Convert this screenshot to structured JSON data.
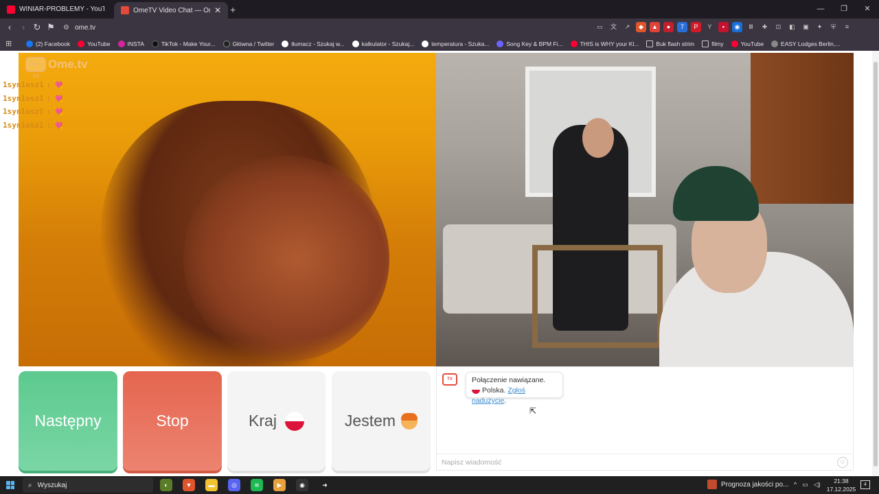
{
  "browser": {
    "tabs": [
      {
        "title": "WINIAR-PROBLEMY - YouTube",
        "favicon_color": "#ff0033"
      },
      {
        "title": "OmeTV Video Chat — Omeg",
        "favicon_color": "#e24b3b",
        "active": true
      }
    ],
    "new_tab_label": "+",
    "url": "ome.tv",
    "bookmarks": [
      {
        "label": "(2) Facebook",
        "icon_color": "#1877f2"
      },
      {
        "label": "YouTube",
        "icon_color": "#ff0033"
      },
      {
        "label": "INSTA",
        "icon_color": "#d6249f"
      },
      {
        "label": "TikTok - Make Your...",
        "icon_color": "#111111"
      },
      {
        "label": "Główna / Twitter",
        "icon_color": "#222222"
      },
      {
        "label": "tłumacz - Szukaj w...",
        "icon_color": "#ffffff"
      },
      {
        "label": "kalkulator - Szukaj...",
        "icon_color": "#ffffff"
      },
      {
        "label": "temperatura - Szuka...",
        "icon_color": "#ffffff"
      },
      {
        "label": "Song Key & BPM Fi...",
        "icon_color": "#6c63ff"
      },
      {
        "label": "THIS is WHY your Kl...",
        "icon_color": "#ff0033"
      },
      {
        "label": "Buk flash strim",
        "icon_color": "folder"
      },
      {
        "label": "filmy",
        "icon_color": "folder"
      },
      {
        "label": "YouTube",
        "icon_color": "#ff0033"
      },
      {
        "label": "EASY Lodges Berlin,...",
        "icon_color": "#888888"
      }
    ]
  },
  "app": {
    "logo_badge": "Ome TV",
    "logo_text": "Ome.tv",
    "overlay_chat": [
      {
        "user": "1syn1usz1",
        "sep": ":",
        "emoji": "💘"
      },
      {
        "user": "1syn1usz1",
        "sep": ":",
        "emoji": "💘"
      },
      {
        "user": "1syn1usz1",
        "sep": ":",
        "emoji": "💘"
      },
      {
        "user": "1syn1usz1",
        "sep": ":",
        "emoji": "💘"
      }
    ],
    "buttons": {
      "next": "Następny",
      "stop": "Stop",
      "country": "Kraj",
      "gender": "Jestem"
    },
    "chat": {
      "status": "Połączenie nawiązane.",
      "country": "Polska.",
      "report_link": "Zgłoś nadużycie",
      "report_suffix": ".",
      "input_placeholder": "Napisz wiadomość"
    }
  },
  "taskbar": {
    "search_placeholder": "Wyszukaj",
    "weather": "Prognoza jakości po...",
    "time": "21:38",
    "date": "17.12.2025",
    "notif_count": "4"
  },
  "colors": {
    "next": "#5dca8f",
    "stop": "#e56650",
    "accent_link": "#3a8bd0",
    "browser_chrome": "#3a3540"
  }
}
